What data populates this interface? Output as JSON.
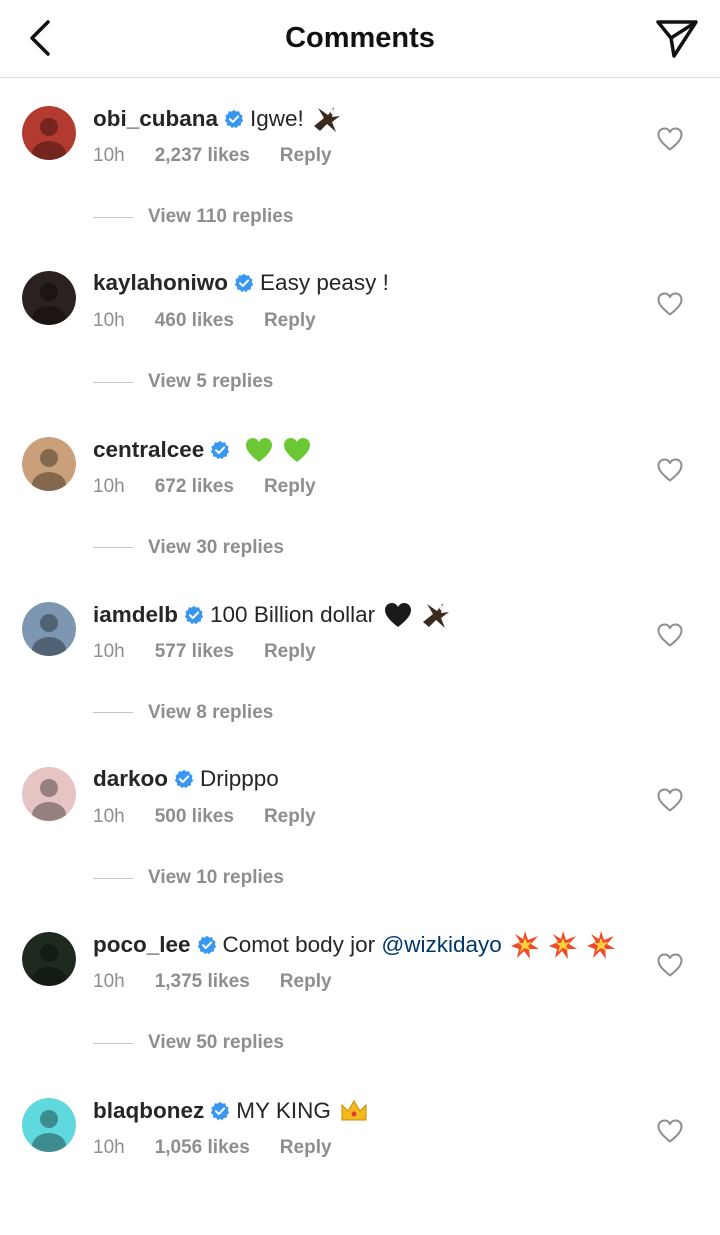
{
  "header": {
    "title": "Comments",
    "back_icon": "chevron-left-icon",
    "share_icon": "paper-plane-icon"
  },
  "comments": [
    {
      "username": "obi_cubana",
      "text": "Igwe!",
      "emoji": [
        "eagle"
      ],
      "time": "10h",
      "likes": "2,237 likes",
      "reply_label": "Reply",
      "view_replies": "View 110 replies",
      "avatar_color": "#b33a2e"
    },
    {
      "username": "kaylahoniwo",
      "text": "Easy peasy !",
      "emoji": [],
      "time": "10h",
      "likes": "460 likes",
      "reply_label": "Reply",
      "view_replies": "View 5 replies",
      "avatar_color": "#2a2220"
    },
    {
      "username": "centralcee",
      "text": "",
      "emoji": [
        "green-heart",
        "green-heart"
      ],
      "time": "10h",
      "likes": "672 likes",
      "reply_label": "Reply",
      "view_replies": "View 30 replies",
      "avatar_color": "#c9a079"
    },
    {
      "username": "iamdelb",
      "text": "100 Billion dollar",
      "emoji": [
        "black-heart",
        "eagle"
      ],
      "time": "10h",
      "likes": "577 likes",
      "reply_label": "Reply",
      "view_replies": "View 8 replies",
      "avatar_color": "#7d97b3"
    },
    {
      "username": "darkoo",
      "text": "Dripppo",
      "emoji": [],
      "time": "10h",
      "likes": "500 likes",
      "reply_label": "Reply",
      "view_replies": "View 10 replies",
      "avatar_color": "#e6c4c4"
    },
    {
      "username": "poco_lee",
      "text": "Comot body jor ",
      "mention": "@wizkidayo",
      "emoji": [
        "collision",
        "collision",
        "collision"
      ],
      "time": "10h",
      "likes": "1,375 likes",
      "reply_label": "Reply",
      "view_replies": "View 50 replies",
      "avatar_color": "#1e2a1e"
    },
    {
      "username": "blaqbonez",
      "text": "MY KING",
      "emoji": [
        "crown"
      ],
      "time": "10h",
      "likes": "1,056 likes",
      "reply_label": "Reply",
      "view_replies": "",
      "avatar_color": "#5fd8de"
    }
  ],
  "colors": {
    "verified": "#3897f0",
    "mention": "#00376b",
    "meta": "#8e8e8e"
  }
}
